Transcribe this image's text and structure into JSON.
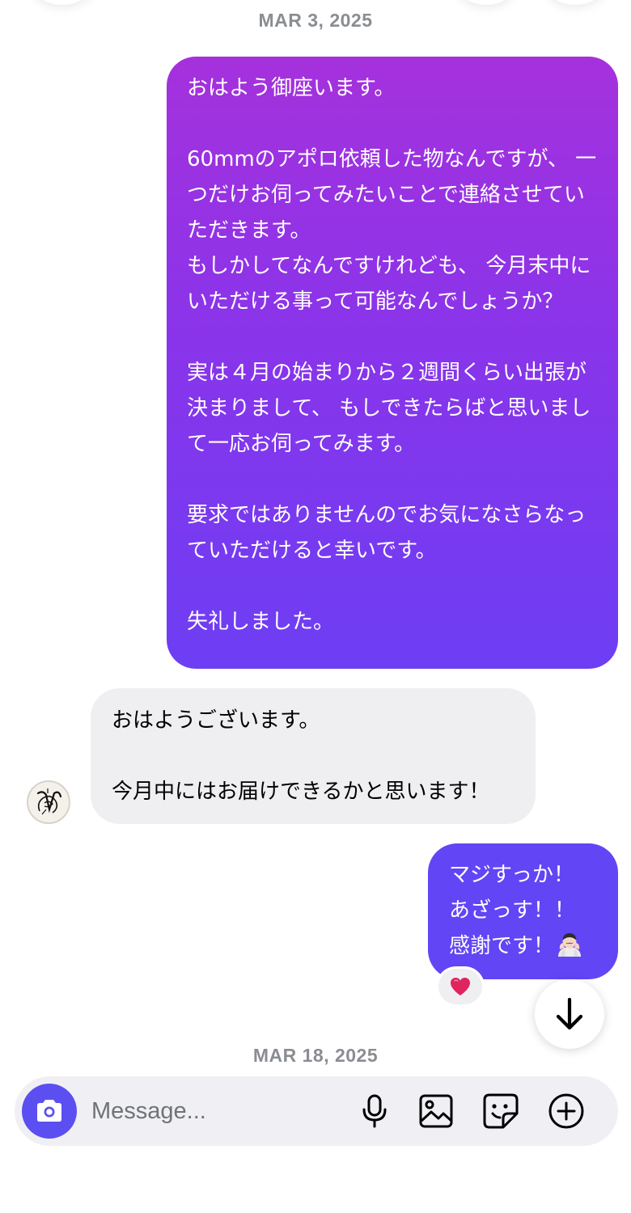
{
  "conversation": {
    "date_1": "MAR 3, 2025",
    "date_2": "MAR 18, 2025"
  },
  "messages": [
    {
      "direction": "sent",
      "text": "おはよう御座います。\n\n60mmのアポロ依頼した物なんですが、 一つだけお伺ってみたいことで連絡させていただきます。\nもしかしてなんですけれども、 今月末中にいただける事って可能なんでしょうか？\n\n実は４月の始まりから２週間くらい出張が決まりまして、 もしできたらばと思いまして一応お伺ってみます。\n\n要求ではありませんのでお気になさらなっていただけると幸いです。\n\n失礼しました。"
    },
    {
      "direction": "received",
      "text": "おはようございます。\n\n今月中にはお届けできるかと思います！"
    },
    {
      "direction": "sent",
      "text": "マジすっか！\nあざっす！！\n感謝です！",
      "emoji": "person-bowing",
      "reaction": "heart"
    }
  ],
  "composer": {
    "placeholder": "Message...",
    "icons": [
      "camera-icon",
      "microphone-icon",
      "gallery-icon",
      "sticker-icon",
      "plus-icon"
    ]
  },
  "colors": {
    "sent_gradient_top": "#a531dc",
    "sent_gradient_bottom": "#6d3ef4",
    "sent_solid": "#6245f5",
    "received_bg": "#efeff2",
    "camera_button": "#5b4ff2",
    "date_text": "#8a8d91",
    "reaction_heart": "#e0245e"
  }
}
